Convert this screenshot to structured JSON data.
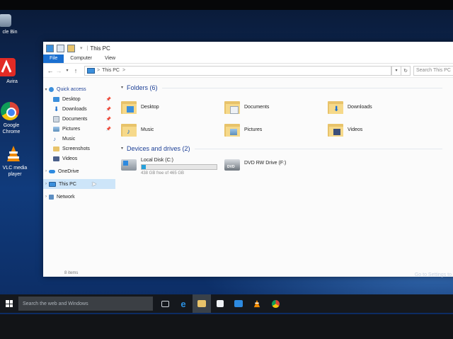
{
  "desktop": {
    "icons": [
      {
        "label": "cle Bin"
      },
      {
        "label": "Avira"
      },
      {
        "label": "Google Chrome"
      },
      {
        "label": "VLC media player"
      }
    ],
    "watermark": {
      "line1": "Go to Settings to"
    }
  },
  "window": {
    "title": "This PC",
    "ribbon": {
      "file": "File",
      "computer": "Computer",
      "view": "View"
    },
    "address": {
      "path": "This PC",
      "chevron": ">"
    },
    "search_placeholder": "Search This PC",
    "nav": {
      "quick_access": "Quick access",
      "items": [
        {
          "label": "Desktop",
          "pinned": true
        },
        {
          "label": "Downloads",
          "pinned": true
        },
        {
          "label": "Documents",
          "pinned": true
        },
        {
          "label": "Pictures",
          "pinned": true
        },
        {
          "label": "Music",
          "pinned": false
        },
        {
          "label": "Screenshots",
          "pinned": false
        },
        {
          "label": "Videos",
          "pinned": false
        }
      ],
      "onedrive": "OneDrive",
      "this_pc": "This PC",
      "network": "Network"
    },
    "folders_title": "Folders (6)",
    "folders": [
      {
        "label": "Desktop"
      },
      {
        "label": "Documents"
      },
      {
        "label": "Downloads"
      },
      {
        "label": "Music"
      },
      {
        "label": "Pictures"
      },
      {
        "label": "Videos"
      }
    ],
    "drives_title": "Devices and drives (2)",
    "drives": [
      {
        "label": "Local Disk (C:)",
        "detail": "438 GB free of 465 GB",
        "used_fraction": 0.06
      },
      {
        "label": "DVD RW Drive (F:)"
      }
    ],
    "status": "8 items"
  },
  "taskbar": {
    "search_placeholder": "Search the web and Windows"
  },
  "colors": {
    "accent": "#1a6fd0",
    "folder": "#f6d98a",
    "drive_bar": "#26a0da"
  }
}
